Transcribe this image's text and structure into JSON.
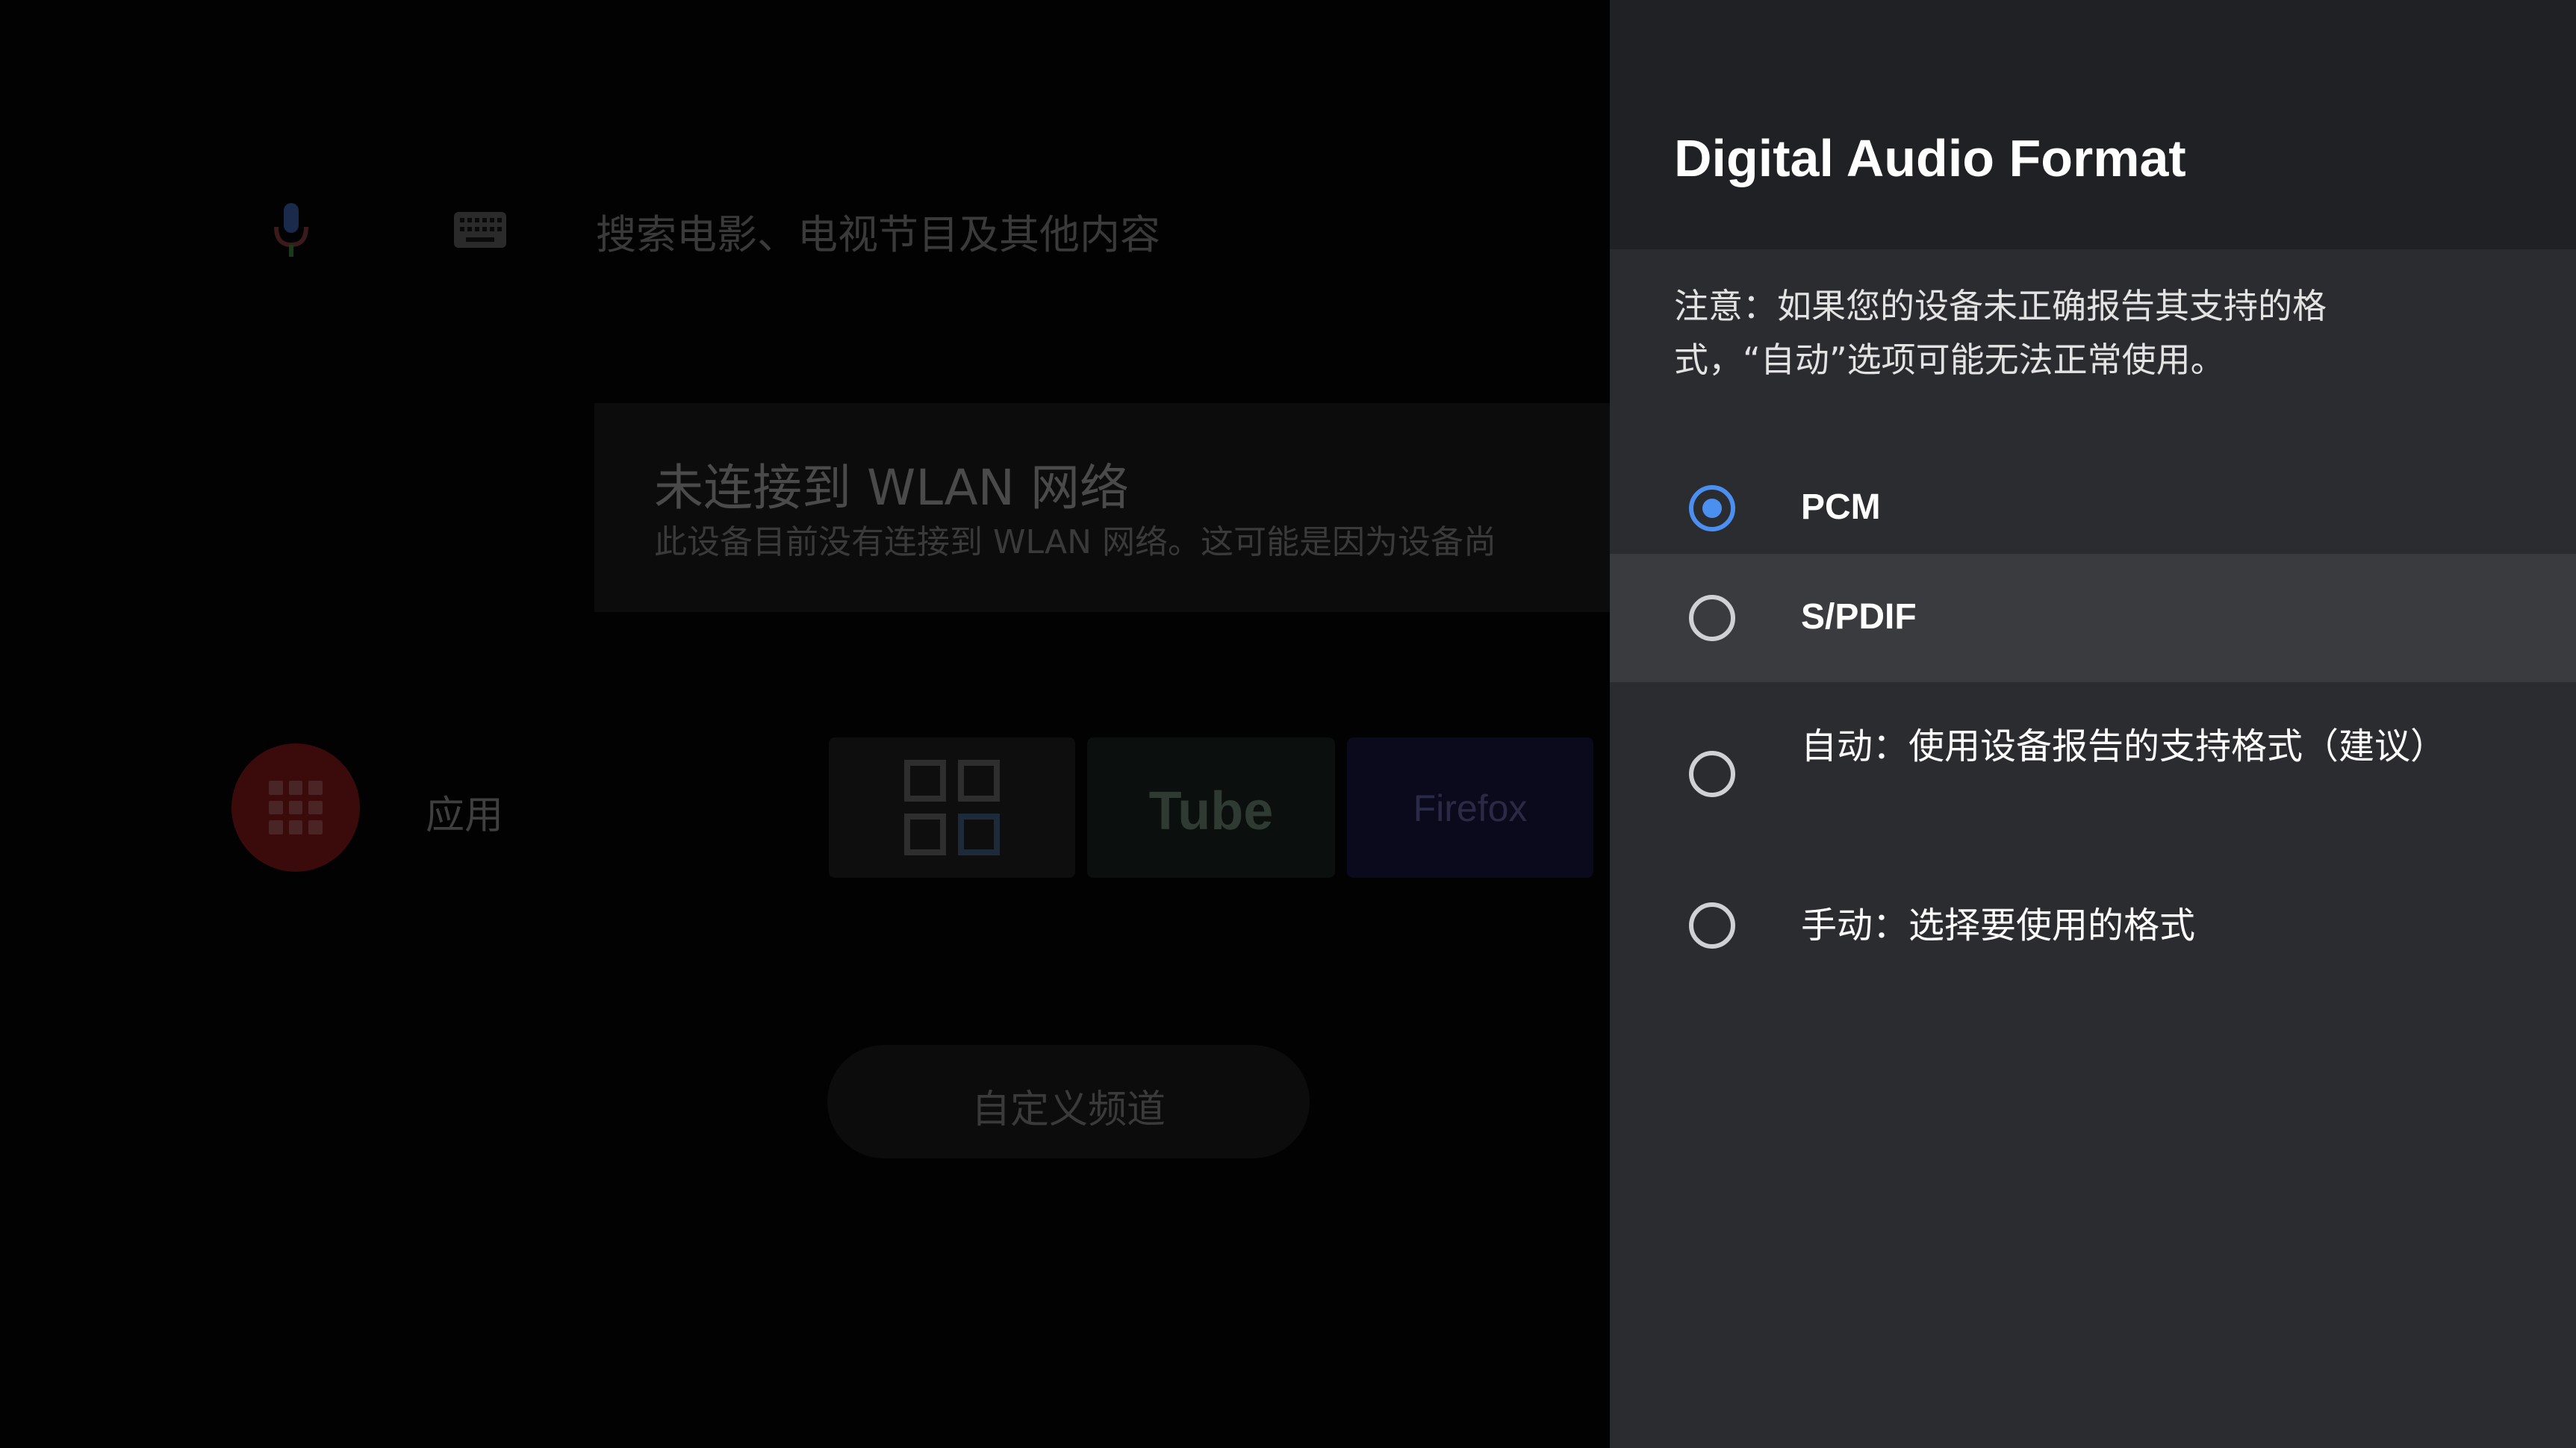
{
  "launcher": {
    "search_placeholder": "搜索电影、电视节目及其他内容",
    "wlan_title": "未连接到 WLAN 网络",
    "wlan_desc": "此设备目前没有连接到 WLAN 网络。这可能是因为设备尚",
    "apps_label": "应用",
    "tiles": [
      "",
      "Tube",
      "Firefox"
    ],
    "custom_channel": "自定义频道"
  },
  "panel": {
    "title": "Digital Audio Format",
    "note": "注意：如果您的设备未正确报告其支持的格式，“自动”选项可能无法正常使用。",
    "options": [
      {
        "label": "PCM",
        "selected": true
      },
      {
        "label": "S/PDIF",
        "selected": false
      },
      {
        "label": "自动：使用设备报告的支持格式（建议）",
        "selected": false
      },
      {
        "label": "手动：选择要使用的格式",
        "selected": false
      }
    ]
  },
  "colors": {
    "accent": "#4b8ff0",
    "panel_header": "#202124",
    "panel_body": "#2b2c2f",
    "focused_row": "#3a3b3e"
  }
}
